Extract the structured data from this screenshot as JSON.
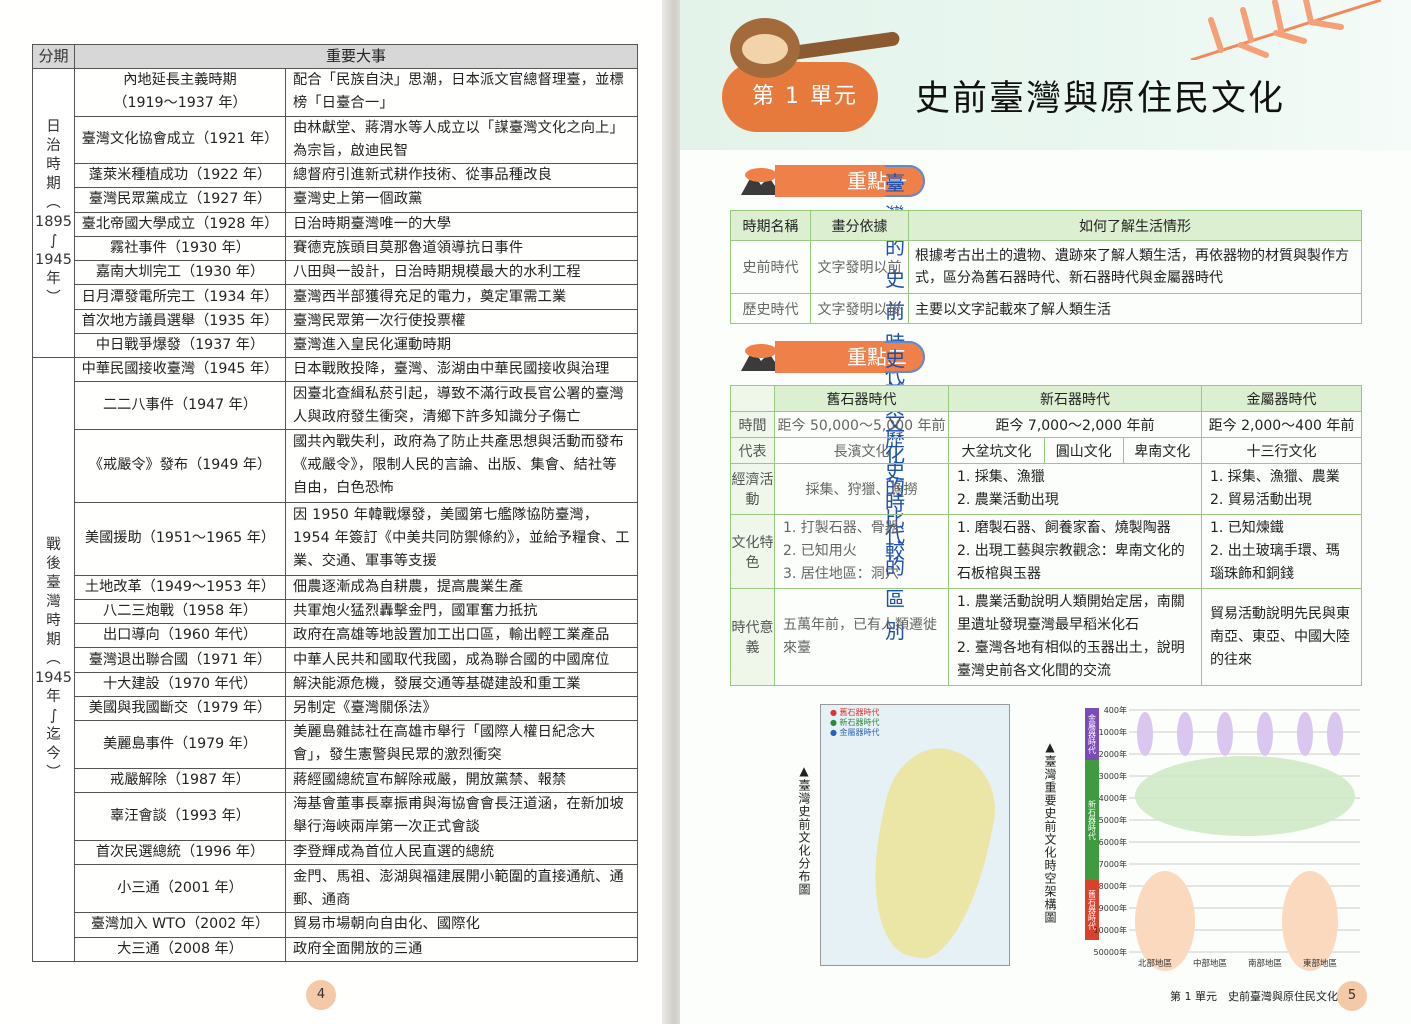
{
  "left": {
    "head_period": "分期",
    "head_events": "重要大事",
    "era_japan": "日\n治\n時\n期\n︵\n1895\n∫\n1945\n年\n︶",
    "era_postwar": "戰\n後\n臺\n灣\n時\n期\n︵\n1945\n年\n∫\n迄\n今\n︶",
    "rows": [
      {
        "event": "內地延長主義時期\n（1919～1937 年）",
        "desc": "配合「民族自決」思潮，日本派文官總督理臺，並標榜「日臺合一」"
      },
      {
        "event": "臺灣文化協會成立（1921 年）",
        "desc": "由林獻堂、蔣渭水等人成立以「謀臺灣文化之向上」為宗旨，啟迪民智"
      },
      {
        "event": "蓬萊米種植成功（1922 年）",
        "desc": "總督府引進新式耕作技術、從事品種改良"
      },
      {
        "event": "臺灣民眾黨成立（1927 年）",
        "desc": "臺灣史上第一個政黨"
      },
      {
        "event": "臺北帝國大學成立（1928 年）",
        "desc": "日治時期臺灣唯一的大學"
      },
      {
        "event": "霧社事件（1930 年）",
        "desc": "賽德克族頭目莫那魯道領導抗日事件"
      },
      {
        "event": "嘉南大圳完工（1930 年）",
        "desc": "八田與一設計，日治時期規模最大的水利工程"
      },
      {
        "event": "日月潭發電所完工（1934 年）",
        "desc": "臺灣西半部獲得充足的電力，奠定軍需工業"
      },
      {
        "event": "首次地方議員選舉（1935 年）",
        "desc": "臺灣民眾第一次行使投票權"
      },
      {
        "event": "中日戰爭爆發（1937 年）",
        "desc": "臺灣進入皇民化運動時期"
      },
      {
        "event": "中華民國接收臺灣（1945 年）",
        "desc": "日本戰敗投降，臺灣、澎湖由中華民國接收與治理"
      },
      {
        "event": "二二八事件（1947 年）",
        "desc": "因臺北查緝私菸引起，導致不滿行政長官公署的臺灣人與政府發生衝突，清鄉下許多知識分子傷亡"
      },
      {
        "event": "《戒嚴令》發布（1949 年）",
        "desc": "國共內戰失利，政府為了防止共產思想與活動而發布《戒嚴令》，限制人民的言論、出版、集會、結社等自由，白色恐怖"
      },
      {
        "event": "美國援助（1951～1965 年）",
        "desc": "因 1950 年韓戰爆發，美國第七艦隊協防臺灣，1954 年簽訂《中美共同防禦條約》，並給予糧食、工業、交通、軍事等支援"
      },
      {
        "event": "土地改革（1949～1953 年）",
        "desc": "佃農逐漸成為自耕農，提高農業生產"
      },
      {
        "event": "八二三炮戰（1958 年）",
        "desc": "共軍炮火猛烈轟擊金門，國軍奮力抵抗"
      },
      {
        "event": "出口導向（1960 年代）",
        "desc": "政府在高雄等地設置加工出口區，輸出輕工業產品"
      },
      {
        "event": "臺灣退出聯合國（1971 年）",
        "desc": "中華人民共和國取代我國，成為聯合國的中國席位"
      },
      {
        "event": "十大建設（1970 年代）",
        "desc": "解決能源危機，發展交通等基礎建設和重工業"
      },
      {
        "event": "美國與我國斷交（1979 年）",
        "desc": "另制定《臺灣關係法》"
      },
      {
        "event": "美麗島事件（1979 年）",
        "desc": "美麗島雜誌社在高雄市舉行「國際人權日紀念大會」，發生憲警與民眾的激烈衝突"
      },
      {
        "event": "戒嚴解除（1987 年）",
        "desc": "蔣經國總統宣布解除戒嚴，開放黨禁、報禁"
      },
      {
        "event": "辜汪會談（1993 年）",
        "desc": "海基會董事長辜振甫與海協會會長汪道涵，在新加坡舉行海峽兩岸第一次正式會談"
      },
      {
        "event": "首次民選總統（1996 年）",
        "desc": "李登輝成為首位人民直選的總統"
      },
      {
        "event": "小三通（2001 年）",
        "desc": "金門、馬祖、澎湖與福建展開小範圍的直接通航、通郵、通商"
      },
      {
        "event": "臺灣加入 WTO（2002 年）",
        "desc": "貿易市場朝向自由化、國際化"
      },
      {
        "event": "大三通（2008 年）",
        "desc": "政府全面開放的三通"
      }
    ],
    "page_number": "4"
  },
  "right": {
    "unit_label": "第 1 單元",
    "unit_title": "史前臺灣與原住民文化",
    "key1_label": "重點一",
    "key1_title": "臺灣的史前時代與歷史時代的區別",
    "t1_head": [
      "時期名稱",
      "畫分依據",
      "如何了解生活情形"
    ],
    "t1_rows": [
      [
        "史前時代",
        "文字發明以前",
        "根據考古出土的遺物、遺跡來了解人類生活，再依器物的材質與製作方式，區分為舊石器時代、新石器時代與金屬器時代"
      ],
      [
        "歷史時代",
        "文字發明以後",
        "主要以文字記載來了解人類生活"
      ]
    ],
    "key2_label": "重點二",
    "key2_title": "史前文化的比較",
    "t2_head": [
      "舊石器時代",
      "新石器時代",
      "金屬器時代"
    ],
    "t2": {
      "time_label": "時間",
      "time": [
        "距今 50,000～5,000 年前",
        "距今 7,000～2,000 年前",
        "距今 2,000～400 年前"
      ],
      "rep_label": "代表",
      "rep_old": "長濱文化",
      "rep_new": [
        "大坌坑文化",
        "圓山文化",
        "卑南文化"
      ],
      "rep_metal": "十三行文化",
      "econ_label": "經濟活動",
      "econ_old": "採集、狩獵、漁撈",
      "econ_new": [
        "1. 採集、漁獵",
        "2. 農業活動出現"
      ],
      "econ_metal": [
        "1. 採集、漁獵、農業",
        "2. 貿易活動出現"
      ],
      "cult_label": "文化特色",
      "cult_old": [
        "1. 打製石器、骨器",
        "2. 已知用火",
        "3. 居住地區：洞穴"
      ],
      "cult_new": [
        "1. 磨製石器、飼養家畜、燒製陶器",
        "2. 出現工藝與宗教觀念：卑南文化的石板棺與玉器"
      ],
      "cult_metal": [
        "1. 已知煉鐵",
        "2. 出土玻璃手環、瑪瑙珠飾和銅錢"
      ],
      "sig_label": "時代意義",
      "sig_old": "五萬年前，已有人類遷徙來臺",
      "sig_new": [
        "1. 農業活動說明人類開始定居，南關里遺址發現臺灣最早稻米化石",
        "2. 臺灣各地有相似的玉器出土，說明臺灣史前各文化間的交流"
      ],
      "sig_metal": "貿易活動說明先民與東南亞、東亞、中國大陸的往來"
    },
    "map_caption": "▲臺灣史前文化分布圖",
    "map_legend": [
      "● 舊石器時代",
      "● 新石器時代",
      "● 金屬器時代"
    ],
    "chart_caption": "▲臺灣重要史前文化時空架構圖",
    "chart_y": [
      "400年",
      "1000年",
      "2000年",
      "3000年",
      "4000年",
      "5000年",
      "6000年",
      "7000年",
      "8000年",
      "9000年",
      "10000年",
      "50000年"
    ],
    "chart_x": [
      "北部地區",
      "中部地區",
      "南部地區",
      "東部地區"
    ],
    "chart_era": [
      "金屬器時代",
      "新石器時代",
      "舊石器時代"
    ],
    "footer": "第 1 單元　史前臺灣與原住民文化",
    "page_number": "5"
  }
}
